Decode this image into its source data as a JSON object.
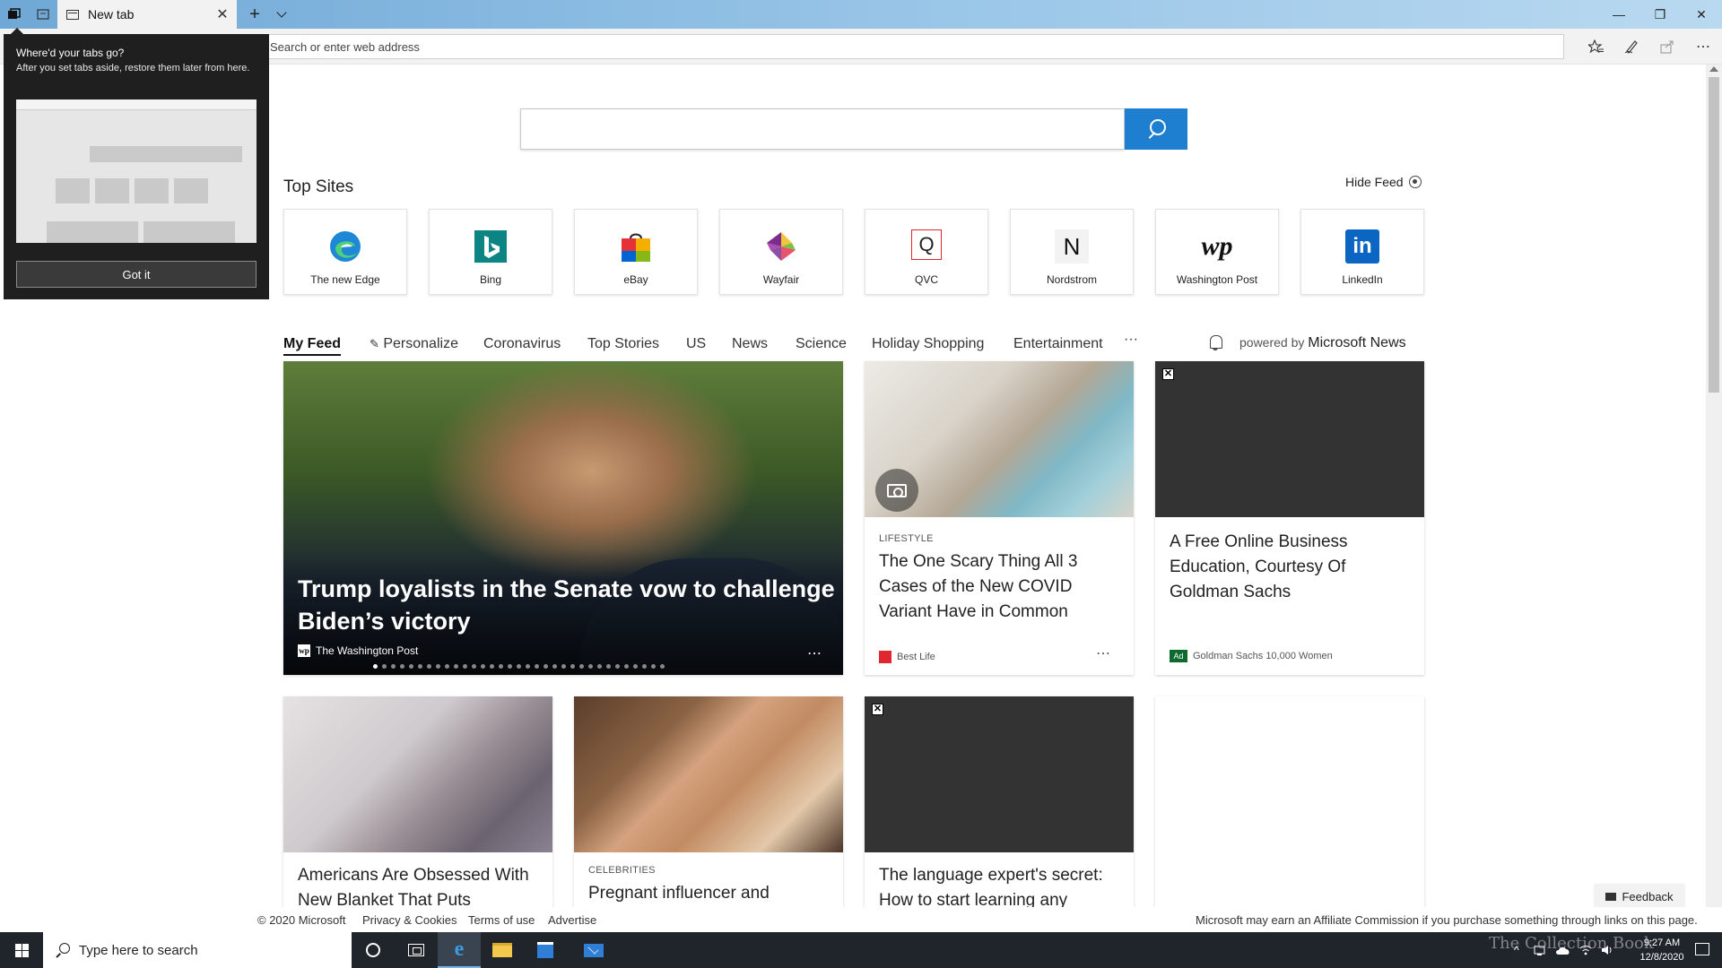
{
  "browser": {
    "tab_title": "New tab",
    "address_placeholder": "Search or enter web address",
    "new_tab_symbol": "+",
    "tab_close_symbol": "✕",
    "window_controls": {
      "minimize": "—",
      "restore": "❐",
      "close": "✕"
    },
    "toolbar_icons": [
      "favorites-icon",
      "pen-icon",
      "share-icon",
      "more-icon"
    ],
    "more_symbol": "⋯"
  },
  "flyout": {
    "title": "Where'd your tabs go?",
    "text": "After you set tabs aside, restore them later from here.",
    "button": "Got it"
  },
  "search": {
    "placeholder": ""
  },
  "top_sites": {
    "title": "Top Sites",
    "hide_feed": "Hide Feed",
    "sites": [
      {
        "label": "The new Edge",
        "icon": "edge-logo"
      },
      {
        "label": "Bing",
        "icon": "bing-logo"
      },
      {
        "label": "eBay",
        "icon": "ebay-logo"
      },
      {
        "label": "Wayfair",
        "icon": "wayfair-logo"
      },
      {
        "label": "QVC",
        "icon": "qvc-logo",
        "logo_text": "Q"
      },
      {
        "label": "Nordstrom",
        "icon": "nordstrom-logo",
        "logo_text": "N"
      },
      {
        "label": "Washington Post",
        "icon": "washington-post-logo",
        "logo_text": "wp"
      },
      {
        "label": "LinkedIn",
        "icon": "linkedin-logo",
        "logo_text": "in"
      }
    ]
  },
  "feed": {
    "nav": [
      "My Feed",
      "Personalize",
      "Coronavirus",
      "Top Stories",
      "US",
      "News",
      "Science",
      "Holiday Shopping",
      "Entertainment"
    ],
    "nav_more": "···",
    "powered_by": "powered by",
    "powered_brand": "Microsoft News",
    "hero": {
      "title": "Trump loyalists in the Senate vow to challenge Biden’s victory",
      "source": "The Washington Post",
      "source_mark": "wp",
      "slide_count": 33,
      "active_slide": 1
    },
    "cards": [
      {
        "category": "LIFESTYLE",
        "title": "The One Scary Thing All 3 Cases of the New COVID Variant Have in Common",
        "source": "Best Life"
      },
      {
        "title": "A Free Online Business Education, Courtesy Of Goldman Sachs",
        "source": "Goldman Sachs 10,000 Women",
        "ad_label": "Ad"
      },
      {
        "title": "Americans Are Obsessed With New Blanket That Puts"
      },
      {
        "category": "CELEBRITIES",
        "title": "Pregnant influencer and"
      },
      {
        "title": "The language expert's secret: How to start learning any"
      }
    ],
    "ad_close": "✕"
  },
  "feedback": "Feedback",
  "footer": {
    "copyright": "© 2020 Microsoft",
    "privacy": "Privacy & Cookies",
    "terms": "Terms of use",
    "advertise": "Advertise",
    "affiliate": "Microsoft may earn an Affiliate Commission if you purchase something through links on this page."
  },
  "taskbar": {
    "search_placeholder": "Type here to search",
    "time": "9:27 AM",
    "date": "12/8/2020",
    "tray_expand": "^",
    "watermark": "The Collection Book"
  }
}
